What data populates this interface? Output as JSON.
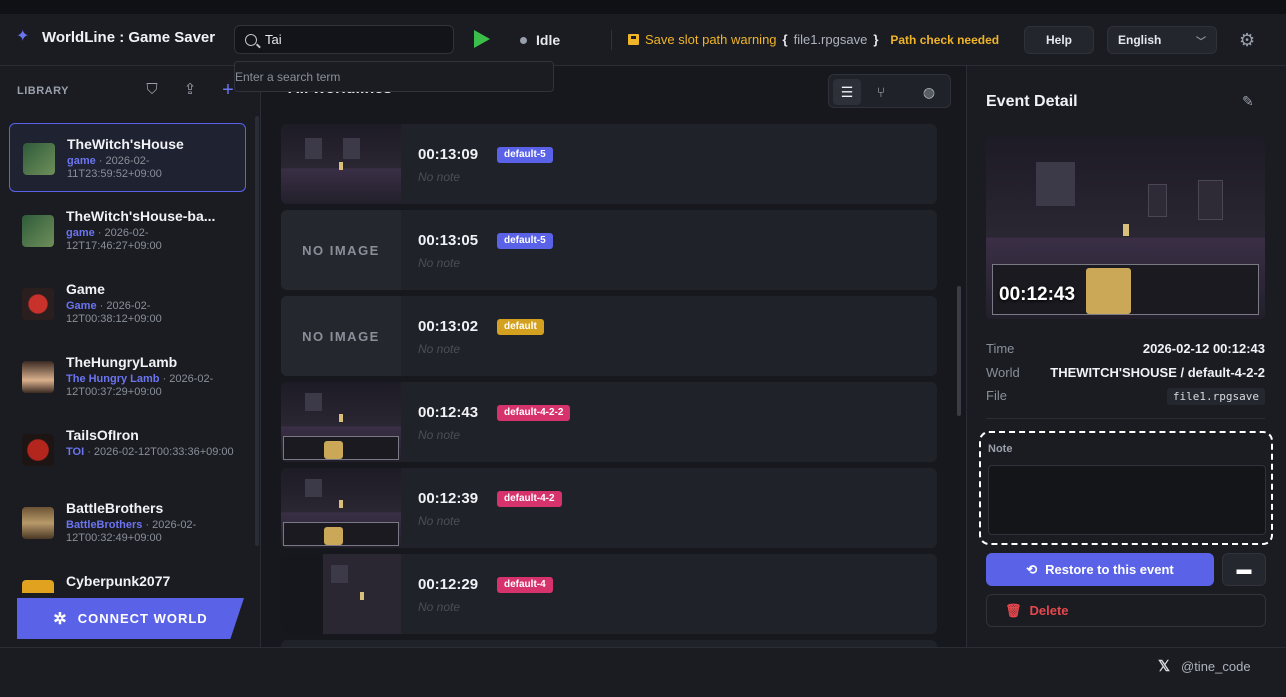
{
  "app": {
    "title": "WorldLine : Game Saver",
    "logo_icon": "worldline-logo-icon"
  },
  "search": {
    "value": "Tai",
    "placeholder": "Enter a search term"
  },
  "status": {
    "label": "Idle"
  },
  "warning": {
    "label": "Save slot path warning",
    "brace_open": "{",
    "file": "file1.rpgsave",
    "brace_close": "}",
    "hint": "Path check needed",
    "color": "#f0b429"
  },
  "toolbar": {
    "help_label": "Help",
    "language": "English"
  },
  "sidebar": {
    "header": "LIBRARY",
    "connect_label": "CONNECT WORLD",
    "games": [
      {
        "name": "TheWitch'sHouse",
        "tag": "game",
        "date": " · 2026-02-11T23:59:52+09:00"
      },
      {
        "name": "TheWitch'sHouse-ba...",
        "tag": "game",
        "date": " · 2026-02-12T17:46:27+09:00"
      },
      {
        "name": "Game",
        "tag": "Game",
        "date": " · 2026-02-12T00:38:12+09:00"
      },
      {
        "name": "TheHungryLamb",
        "tag": "The Hungry Lamb",
        "date": " · 2026-02-12T00:37:29+09:00"
      },
      {
        "name": "TailsOfIron",
        "tag": "TOI",
        "date": " · 2026-02-12T00:33:36+09:00"
      },
      {
        "name": "BattleBrothers",
        "tag": "BattleBrothers",
        "date": " · 2026-02-12T00:32:49+09:00"
      },
      {
        "name": "Cyberpunk2077",
        "tag": "",
        "date": ""
      }
    ]
  },
  "main": {
    "heading": "All worldlines",
    "no_image": "NO IMAGE",
    "events": [
      {
        "time": "00:13:09",
        "tag": "default-5",
        "tag_color": "#5a63e8",
        "note": "No note",
        "image": true
      },
      {
        "time": "00:13:05",
        "tag": "default-5",
        "tag_color": "#5a63e8",
        "note": "No note",
        "image": false
      },
      {
        "time": "00:13:02",
        "tag": "default",
        "tag_color": "#d4a020",
        "note": "No note",
        "image": false
      },
      {
        "time": "00:12:43",
        "tag": "default-4-2-2",
        "tag_color": "#d6336c",
        "note": "No note",
        "image": true
      },
      {
        "time": "00:12:39",
        "tag": "default-4-2",
        "tag_color": "#d6336c",
        "note": "No note",
        "image": true
      },
      {
        "time": "00:12:29",
        "tag": "default-4",
        "tag_color": "#d6336c",
        "note": "No note",
        "image": true
      }
    ]
  },
  "detail": {
    "title": "Event Detail",
    "overlay_time": "00:12:43",
    "time_label": "Time",
    "time_value": "2026-02-12 00:12:43",
    "world_label": "World",
    "world_value": "THEWITCH'SHOUSE / default-4-2-2",
    "file_label": "File",
    "file_value": "file1.rpgsave",
    "note_label": "Note",
    "note_value": "",
    "restore_label": "Restore to this event",
    "delete_label": "Delete"
  },
  "footer": {
    "handle": "@tine_code"
  },
  "colors": {
    "accent": "#5a63e8",
    "danger": "#e5484d",
    "play": "#3bbf4a"
  }
}
